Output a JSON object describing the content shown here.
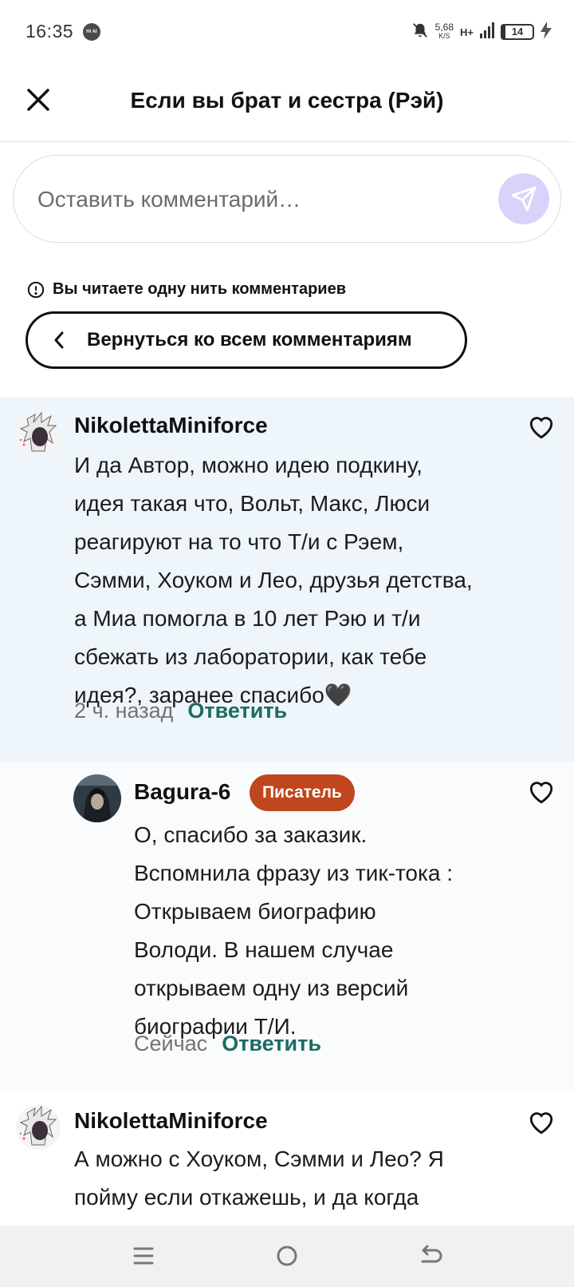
{
  "status_bar": {
    "time": "16:35",
    "app_icon_text": "Hi AI",
    "net_speed_value": "5,68",
    "net_speed_unit": "K/S",
    "network_type": "H+",
    "battery_level": "14"
  },
  "header": {
    "title": "Если вы брат и сестра (Рэй)"
  },
  "comment_input": {
    "placeholder": "Оставить комментарий…"
  },
  "thread": {
    "notice": "Вы читаете одну нить комментариев",
    "back_label": "Вернуться ко всем комментариям"
  },
  "comments": [
    {
      "author": "NikolettaMiniforce",
      "lines": [
        "И да Автор, можно идею подкину,",
        "идея такая что, Вольт, Макс, Люси",
        "реагируют на то что Т/и с Рэем,",
        "Сэмми, Хоуком и Лео, друзья детства,",
        "а Миа помогла  в 10 лет Рэю и т/и",
        "сбежать из лаборатории, как тебе",
        "идея?, заранее спасибо🖤"
      ],
      "time": "2 ч. назад",
      "reply": "Ответить"
    },
    {
      "author": "Bagura-6",
      "badge": "Писатель",
      "lines": [
        "О, спасибо за заказик.",
        "Вспомнила фразу из тик-тока :",
        "Открываем биографию",
        "Володи. В нашем случае",
        "открываем одну из версий",
        "биографии Т/И."
      ],
      "time": "Сейчас",
      "reply": "Ответить"
    },
    {
      "author": "NikolettaMiniforce",
      "lines": [
        "А можно с Хоуком, Сэмми и Лео? Я",
        "пойму если откажешь, и да когда"
      ]
    }
  ],
  "colors": {
    "accent_green": "#1e6b63",
    "badge_orange": "#c0461d",
    "highlight_bg": "#eef6fb",
    "send_button_bg": "#d8d3fb"
  }
}
